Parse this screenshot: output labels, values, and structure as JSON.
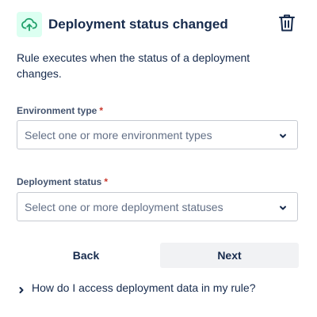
{
  "header": {
    "icon": "cloud-upload-icon",
    "title": "Deployment status changed",
    "delete_icon": "trash-icon"
  },
  "description": "Rule executes when the status of a deployment changes.",
  "fields": {
    "environment_type": {
      "label": "Environment type",
      "required_marker": "*",
      "placeholder": "Select one or more environment types"
    },
    "deployment_status": {
      "label": "Deployment status",
      "required_marker": "*",
      "placeholder": "Select one or more deployment statuses"
    }
  },
  "actions": {
    "back_label": "Back",
    "next_label": "Next"
  },
  "help": {
    "text": "How do I access deployment data in my rule?"
  },
  "colors": {
    "icon_background": "#dcfff1",
    "icon_stroke": "#22a06b",
    "required": "#c9372c",
    "next_button_background": "#f1f2f4"
  }
}
